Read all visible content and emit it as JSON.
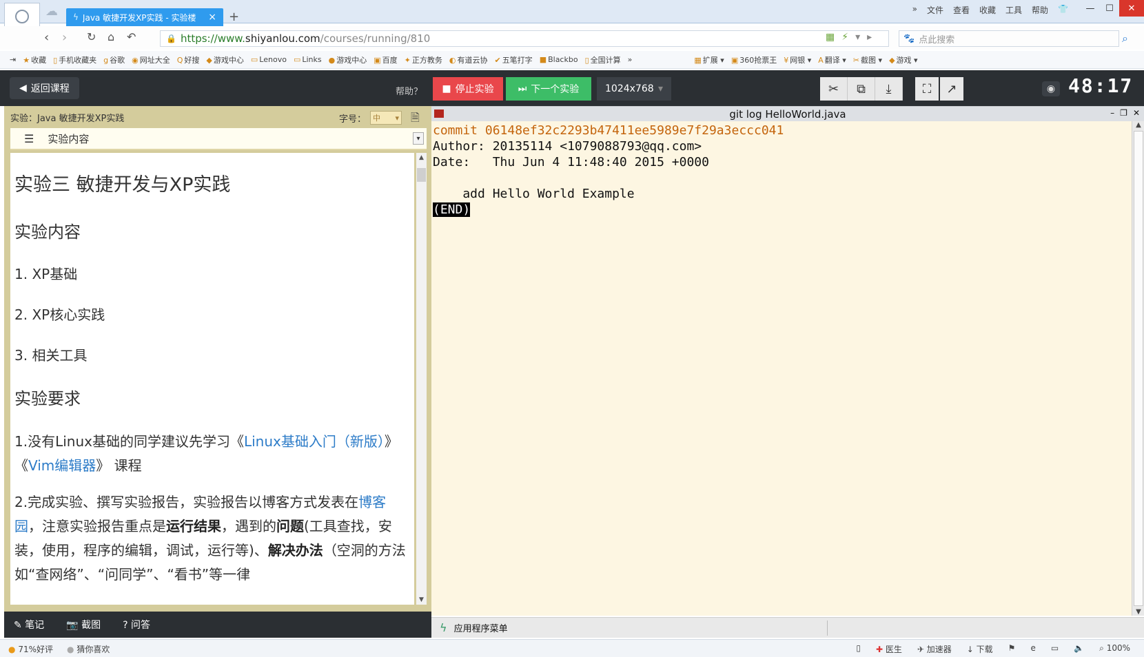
{
  "browser": {
    "tab_title": "Java 敏捷开发XP实践 - 实验楼",
    "new_tab": "+",
    "menu": [
      "文件",
      "查看",
      "收藏",
      "工具",
      "帮助"
    ],
    "url_scheme": "https://www.",
    "url_host": "shiyanlou.com",
    "url_path": "/courses/running/810",
    "search_placeholder": "点此搜索",
    "bookmarks": [
      "收藏",
      "手机收藏夹",
      "谷歌",
      "网址大全",
      "好搜",
      "游戏中心",
      "Lenovo",
      "Links",
      "游戏中心",
      "百度",
      "正方教务",
      "有道云协",
      "五笔打字",
      "Blackbo",
      "全国计算"
    ],
    "extensions": [
      "扩展",
      "360抢票王",
      "网银",
      "翻译",
      "截图",
      "游戏"
    ]
  },
  "labbar": {
    "back_label": "返回课程",
    "help_label": "帮助？",
    "stop_label": "停止实验",
    "next_label": "下一个实验",
    "resolution": "1024x768",
    "timer": "48:17"
  },
  "doc": {
    "header": "实验：Java 敏捷开发XP实践",
    "font_label": "字号：",
    "font_value": "中",
    "toc_label": "实验内容",
    "title": "实验三 敏捷开发与XP实践",
    "section1": "实验内容",
    "items": [
      "1. XP基础",
      "2. XP核心实践",
      "3. 相关工具"
    ],
    "section2": "实验要求",
    "req1_prefix": "1.没有Linux基础的同学建议先学习《",
    "req1_link1": "Linux基础入门（新版）",
    "req1_mid": "》《",
    "req1_link2": "Vim编辑器",
    "req1_suffix": "》 课程",
    "req2_prefix": "2.完成实验、撰写实验报告，实验报告以博客方式发表在",
    "req2_link": "博客园",
    "req2_a": "，注意实验报告重点是",
    "req2_b1": "运行结果",
    "req2_c": "，遇到的",
    "req2_b2": "问题",
    "req2_d": "(工具查找，安装，使用，程序的编辑，调试，运行等)、",
    "req2_b3": "解决办法",
    "req2_e": "（空洞的方法如“查网络”、“问同学”、“看书”等一律",
    "footer": [
      "笔记",
      "截图",
      "问答"
    ]
  },
  "terminal": {
    "title": "git log HelloWorld.java",
    "commit_line": "commit 06148ef32c2293b47411ee5989e7f29a3eccc041",
    "author_line": "Author: 20135114 <1079088793@qq.com>",
    "date_line": "Date:   Thu Jun 4 11:48:40 2015 +0000",
    "message_line": "    add Hello World Example",
    "end_marker": "(END)",
    "taskbar_label": "应用程序菜单"
  },
  "statusbar": {
    "left": [
      "71%好评",
      "猜你喜欢"
    ],
    "right": [
      "医生",
      "加速器",
      "下载",
      "100%"
    ]
  },
  "colors": {
    "stop": "#e9474b",
    "next": "#3dbd67",
    "tab": "#2f9bee",
    "commit": "#c4640c",
    "link": "#2d7cc8"
  }
}
